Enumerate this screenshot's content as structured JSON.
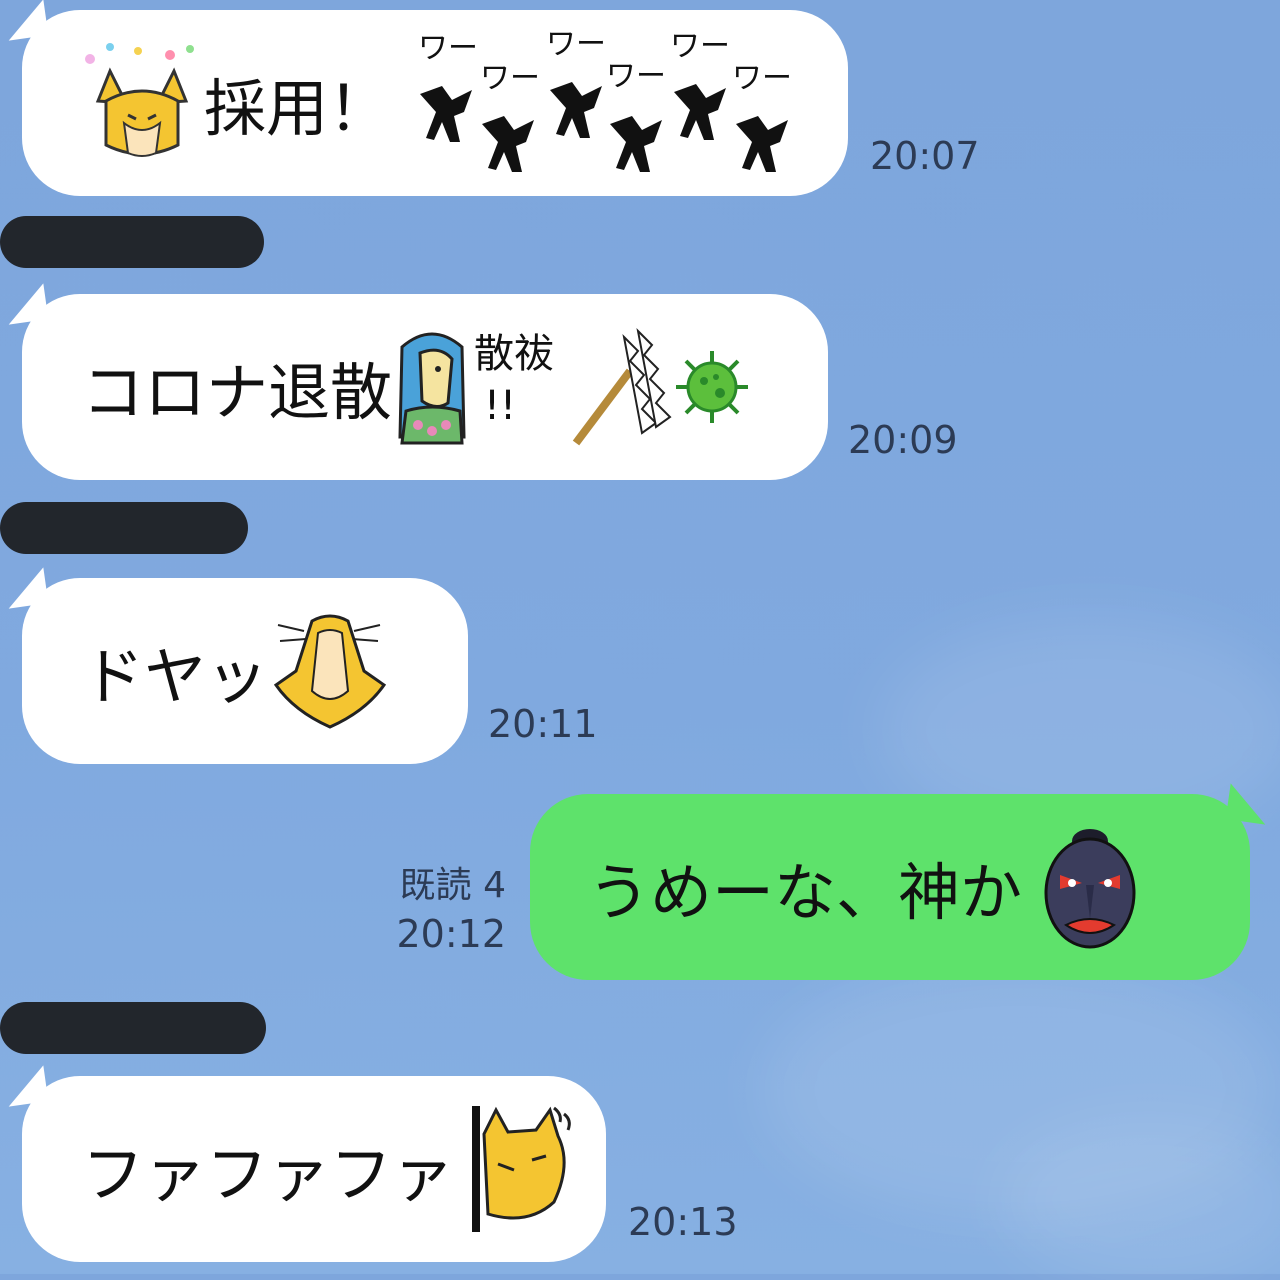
{
  "messages": [
    {
      "id": "m1",
      "side": "left",
      "text": "採用！",
      "time": "20:07"
    },
    {
      "id": "m2",
      "side": "left",
      "text": "コロナ退散",
      "time": "20:09"
    },
    {
      "id": "m3",
      "side": "left",
      "text": "ドヤッ",
      "time": "20:11"
    },
    {
      "id": "m4",
      "side": "right",
      "text": "うめーな、神か",
      "time": "20:12",
      "read": "既読 4"
    },
    {
      "id": "m5",
      "side": "left",
      "text": "ファファファ",
      "time": "20:13"
    }
  ],
  "emoji": {
    "wa_text": "ワー",
    "sanka_text": "散祓",
    "exclaim": "!!"
  },
  "icons": {
    "fox": "fox-cheer-icon",
    "crows": "crow-icon",
    "amabie": "amabie-icon",
    "virus": "virus-icon",
    "mask": "tengu-mask-icon"
  },
  "colors": {
    "background": "#7ea6dc",
    "bubble_left": "#ffffff",
    "bubble_right": "#5ee26b",
    "redaction": "#22262c"
  }
}
